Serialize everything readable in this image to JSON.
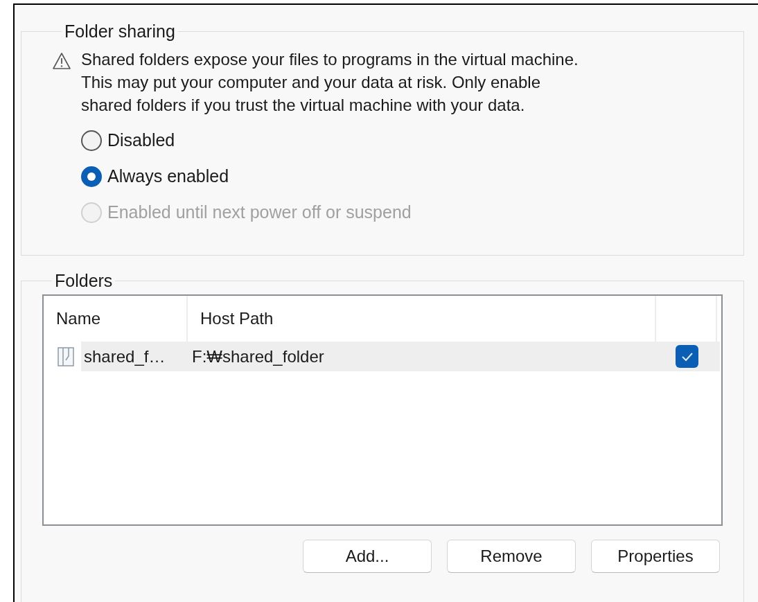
{
  "folder_sharing": {
    "title": "Folder sharing",
    "warning": "Shared folders expose your files to programs in the virtual machine.\nThis may put your computer and your data at risk. Only enable\nshared folders if you trust the virtual machine with your data.",
    "options": [
      {
        "label": "Disabled",
        "selected": false,
        "disabled": false
      },
      {
        "label": "Always enabled",
        "selected": true,
        "disabled": false
      },
      {
        "label": "Enabled until next power off or suspend",
        "selected": false,
        "disabled": true
      }
    ]
  },
  "folders": {
    "title": "Folders",
    "table": {
      "columns": [
        "Name",
        "Host Path"
      ],
      "rows": [
        {
          "name": "shared_f…",
          "host_path": "F:₩shared_folder",
          "checked": true,
          "selected": true
        }
      ]
    },
    "buttons": [
      "Add...",
      "Remove",
      "Properties"
    ]
  }
}
